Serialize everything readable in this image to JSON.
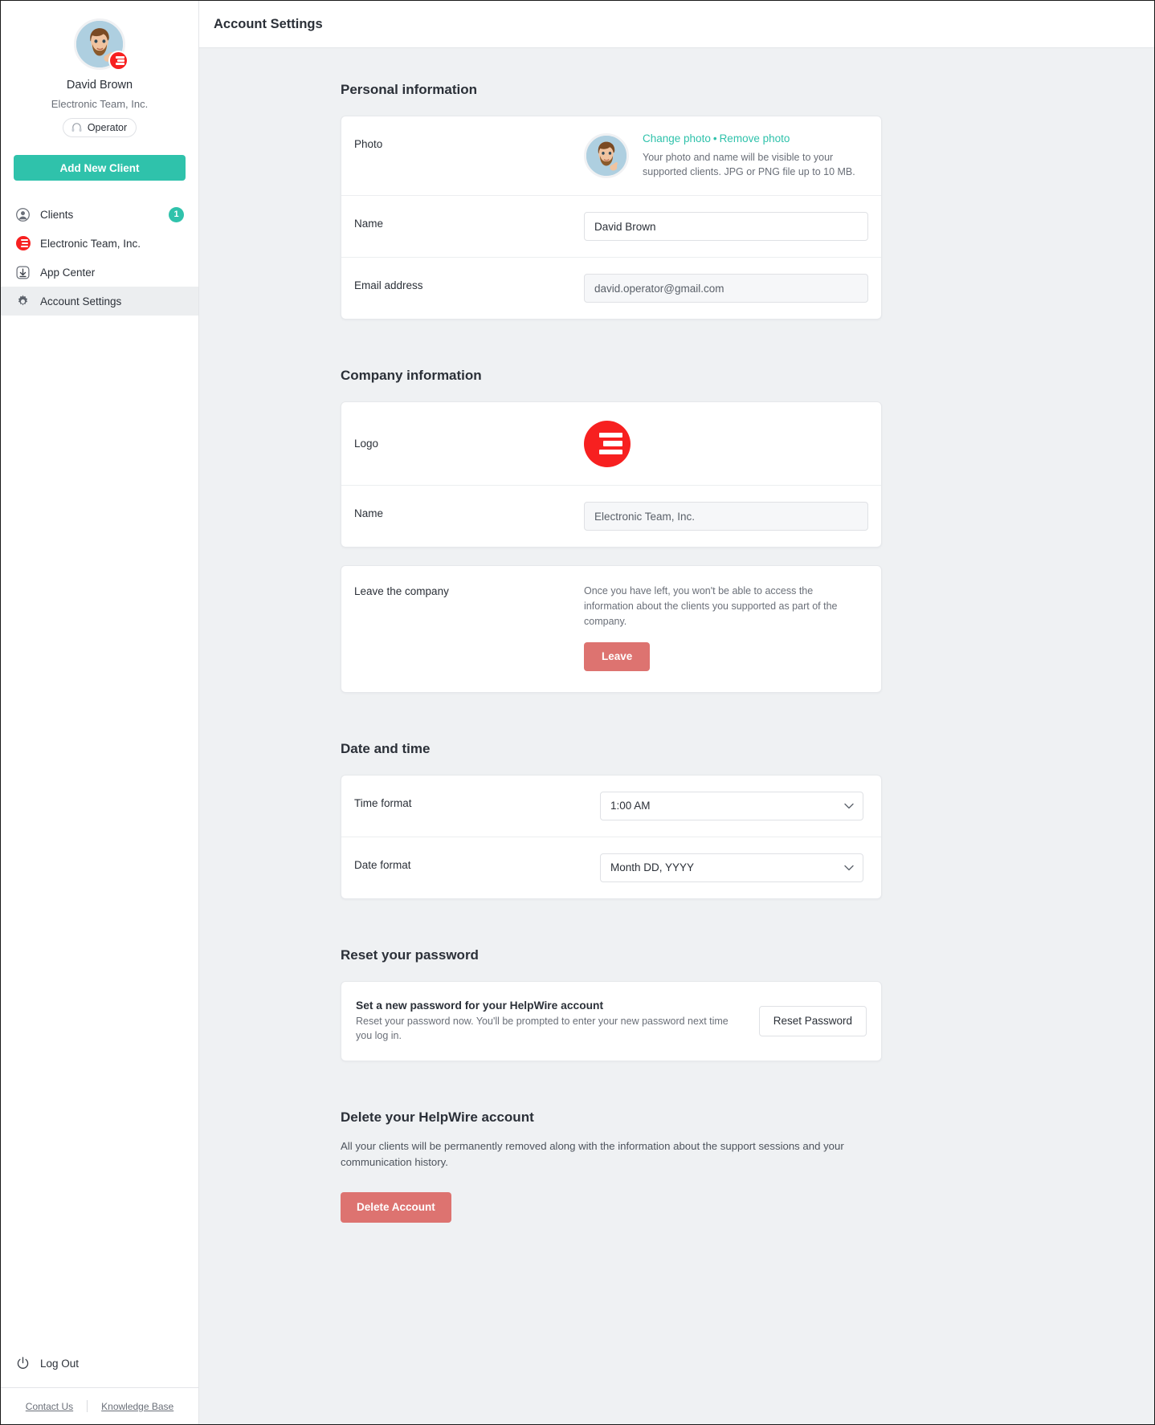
{
  "sidebar": {
    "profile": {
      "name": "David Brown",
      "company": "Electronic Team, Inc.",
      "role": "Operator"
    },
    "add_client_button": "Add New Client",
    "items": [
      {
        "label": "Clients",
        "icon": "user-circle-icon",
        "badge": "1"
      },
      {
        "label": "Electronic Team, Inc.",
        "icon": "company-logo-icon",
        "badge": ""
      },
      {
        "label": "App Center",
        "icon": "download-box-icon",
        "badge": ""
      },
      {
        "label": "Account Settings",
        "icon": "gear-icon",
        "badge": ""
      }
    ],
    "logout": "Log Out",
    "footer": {
      "contact": "Contact Us",
      "knowledge_base": "Knowledge Base"
    }
  },
  "header": {
    "title": "Account Settings"
  },
  "personal": {
    "title": "Personal information",
    "photo_label": "Photo",
    "change_photo": "Change photo",
    "separator": "•",
    "remove_photo": "Remove photo",
    "photo_hint_line1": "Your photo and name will be visible to your supported clients.",
    "photo_hint_line2": "JPG or PNG file up to 10 MB.",
    "name_label": "Name",
    "name_value": "David Brown",
    "email_label": "Email address",
    "email_value": "david.operator@gmail.com"
  },
  "company": {
    "title": "Company information",
    "logo_label": "Logo",
    "name_label": "Name",
    "name_value": "Electronic Team, Inc.",
    "leave_label": "Leave the company",
    "leave_text": "Once you have left, you won't be able to access the information about the clients you supported as part of the company.",
    "leave_button": "Leave"
  },
  "datetime": {
    "title": "Date and time",
    "time_format_label": "Time format",
    "time_format_value": "1:00 AM",
    "date_format_label": "Date format",
    "date_format_value": "Month DD, YYYY"
  },
  "password": {
    "title": "Reset your password",
    "card_title": "Set a new password for your HelpWire account",
    "card_sub": "Reset your password now. You'll be prompted to enter your new password next time you log in.",
    "button": "Reset Password"
  },
  "delete": {
    "title": "Delete your HelpWire account",
    "text": "All your clients will be permanently removed along with the information about the support sessions and your communication history.",
    "button": "Delete Account"
  },
  "colors": {
    "accent": "#2fc2ab",
    "brand_red": "#f72020",
    "danger": "#dd7370",
    "page_bg": "#eff1f3"
  }
}
